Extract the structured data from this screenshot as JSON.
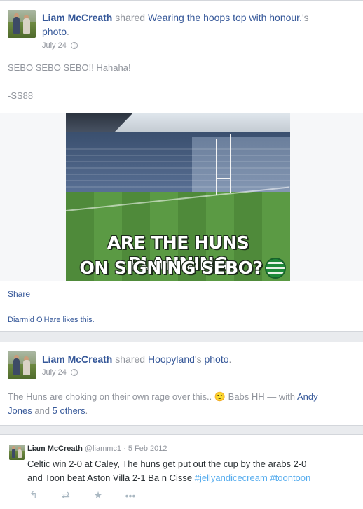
{
  "post1": {
    "author": "Liam McCreath",
    "shared_word": "shared",
    "page_name": "Wearing the hoops top with honour.",
    "possessive": "'s",
    "object": "photo",
    "period": ".",
    "date": "July 24",
    "text_line1": "SEBO SEBO SEBO!! Hahaha!",
    "text_line2": "-SS88",
    "meme_line1": "ARE THE HUNS PLANNING",
    "meme_line2": "ON SIGNING SEBO?",
    "share_label": "Share",
    "likes_text": "Diarmid O'Hare likes this."
  },
  "post2": {
    "author": "Liam McCreath",
    "shared_word": "shared",
    "page_name": "Hoopyland",
    "possessive": "'s",
    "object": "photo",
    "period": ".",
    "date": "July 24",
    "text_part1": "The Huns are choking on their own rage over this..",
    "emoji": "🙂",
    "text_part2": "Babs HH — with",
    "tag_name": "Andy",
    "tag_name2": "Jones",
    "and_word": "and",
    "others": "5 others",
    "end_period": "."
  },
  "tweet": {
    "author": "Liam McCreath",
    "handle": "@liammc1",
    "date": "· 5 Feb 2012",
    "text_line1": "Celtic win 2-0 at Caley, The huns get put out the cup by the arabs 2-0",
    "text_line2": "and Toon beat Aston Villa 2-1 Ba n Cisse",
    "hashtag1": "#jellyandicecream",
    "hashtag2": "#toontoon",
    "actions": [
      "reply-icon",
      "retweet-icon",
      "favorite-icon",
      "more-icon"
    ]
  },
  "colors": {
    "link": "#365899",
    "muted": "#90949c",
    "hashtag": "#55acee"
  }
}
